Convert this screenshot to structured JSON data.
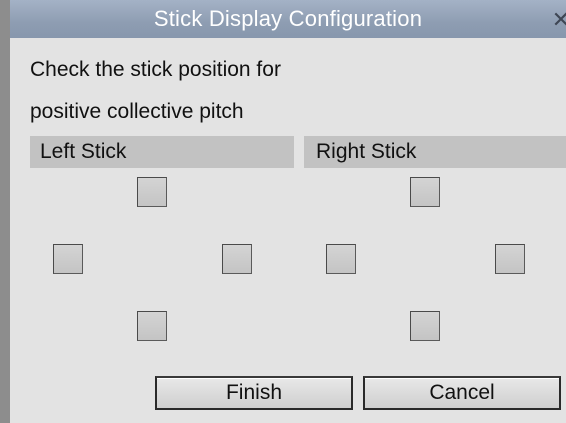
{
  "window": {
    "title": "Stick Display Configuration",
    "close_glyph": "✕"
  },
  "prompt": {
    "line1": "Check the stick position for",
    "line2": "positive collective pitch"
  },
  "sticks": {
    "left": {
      "header": "Left Stick",
      "positions": {
        "up": false,
        "left": false,
        "right": false,
        "down": false
      }
    },
    "right": {
      "header": "Right Stick",
      "positions": {
        "up": false,
        "left": false,
        "right": false,
        "down": false
      }
    }
  },
  "buttons": {
    "finish": "Finish",
    "cancel": "Cancel"
  }
}
